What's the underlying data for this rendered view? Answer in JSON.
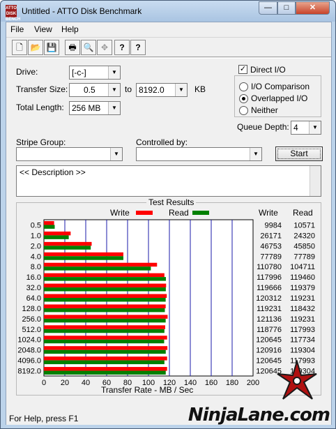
{
  "window": {
    "title": "Untitled - ATTO Disk Benchmark",
    "app_icon_text": "ATTO DISK BENCH"
  },
  "controls": {
    "minimize": "—",
    "maximize": "□",
    "close": "✕"
  },
  "menu": [
    "File",
    "View",
    "Help"
  ],
  "toolbar": [
    {
      "name": "new-icon",
      "glyph": "🗋"
    },
    {
      "name": "open-icon",
      "glyph": "📂"
    },
    {
      "name": "save-icon",
      "glyph": "💾"
    },
    {
      "name": "print-icon",
      "glyph": "🖶"
    },
    {
      "name": "print-preview-icon",
      "glyph": "🔍"
    },
    {
      "name": "move-icon",
      "glyph": "✥"
    },
    {
      "name": "help-icon",
      "glyph": "?"
    },
    {
      "name": "context-help-icon",
      "glyph": "?"
    }
  ],
  "settings": {
    "drive_label": "Drive:",
    "drive_value": "[-c-]",
    "transfer_size_label": "Transfer Size:",
    "transfer_from": "0.5",
    "to_label": "to",
    "transfer_to": "8192.0",
    "kb_label": "KB",
    "total_length_label": "Total Length:",
    "total_length_value": "256 MB",
    "direct_io_label": "Direct I/O",
    "io_comparison_label": "I/O Comparison",
    "overlapped_io_label": "Overlapped I/O",
    "neither_label": "Neither",
    "queue_depth_label": "Queue Depth:",
    "queue_depth_value": "4",
    "stripe_group_label": "Stripe Group:",
    "controlled_by_label": "Controlled by:",
    "start_label": "Start",
    "description": "<< Description >>"
  },
  "results": {
    "title": "Test Results",
    "write_legend": "Write",
    "read_legend": "Read",
    "write_col": "Write",
    "read_col": "Read",
    "write_color": "#ff0000",
    "read_color": "#008000",
    "axis_title": "Transfer Rate - MB / Sec"
  },
  "chart_data": {
    "type": "bar",
    "orientation": "horizontal",
    "xlim": [
      0,
      200
    ],
    "xticks": [
      "0",
      "20",
      "40",
      "60",
      "80",
      "100",
      "120",
      "140",
      "160",
      "180",
      "200"
    ],
    "categories": [
      "0.5",
      "1.0",
      "2.0",
      "4.0",
      "8.0",
      "16.0",
      "32.0",
      "64.0",
      "128.0",
      "256.0",
      "512.0",
      "1024.0",
      "2048.0",
      "4096.0",
      "8192.0"
    ],
    "xlabel": "Transfer Rate - MB / Sec",
    "series": [
      {
        "name": "Write",
        "values_kbps": [
          "9984",
          "26171",
          "46753",
          "77789",
          "110780",
          "117996",
          "119666",
          "120312",
          "119231",
          "121136",
          "118776",
          "120645",
          "120916",
          "120645",
          "120645"
        ]
      },
      {
        "name": "Read",
        "values_kbps": [
          "10571",
          "24320",
          "45850",
          "77789",
          "104711",
          "119460",
          "119379",
          "119231",
          "118432",
          "119231",
          "117993",
          "117734",
          "119304",
          "117993",
          "119304"
        ]
      }
    ],
    "grid": true,
    "legend": "top"
  },
  "status": "For Help, press F1",
  "watermark": "NinjaLane.com"
}
